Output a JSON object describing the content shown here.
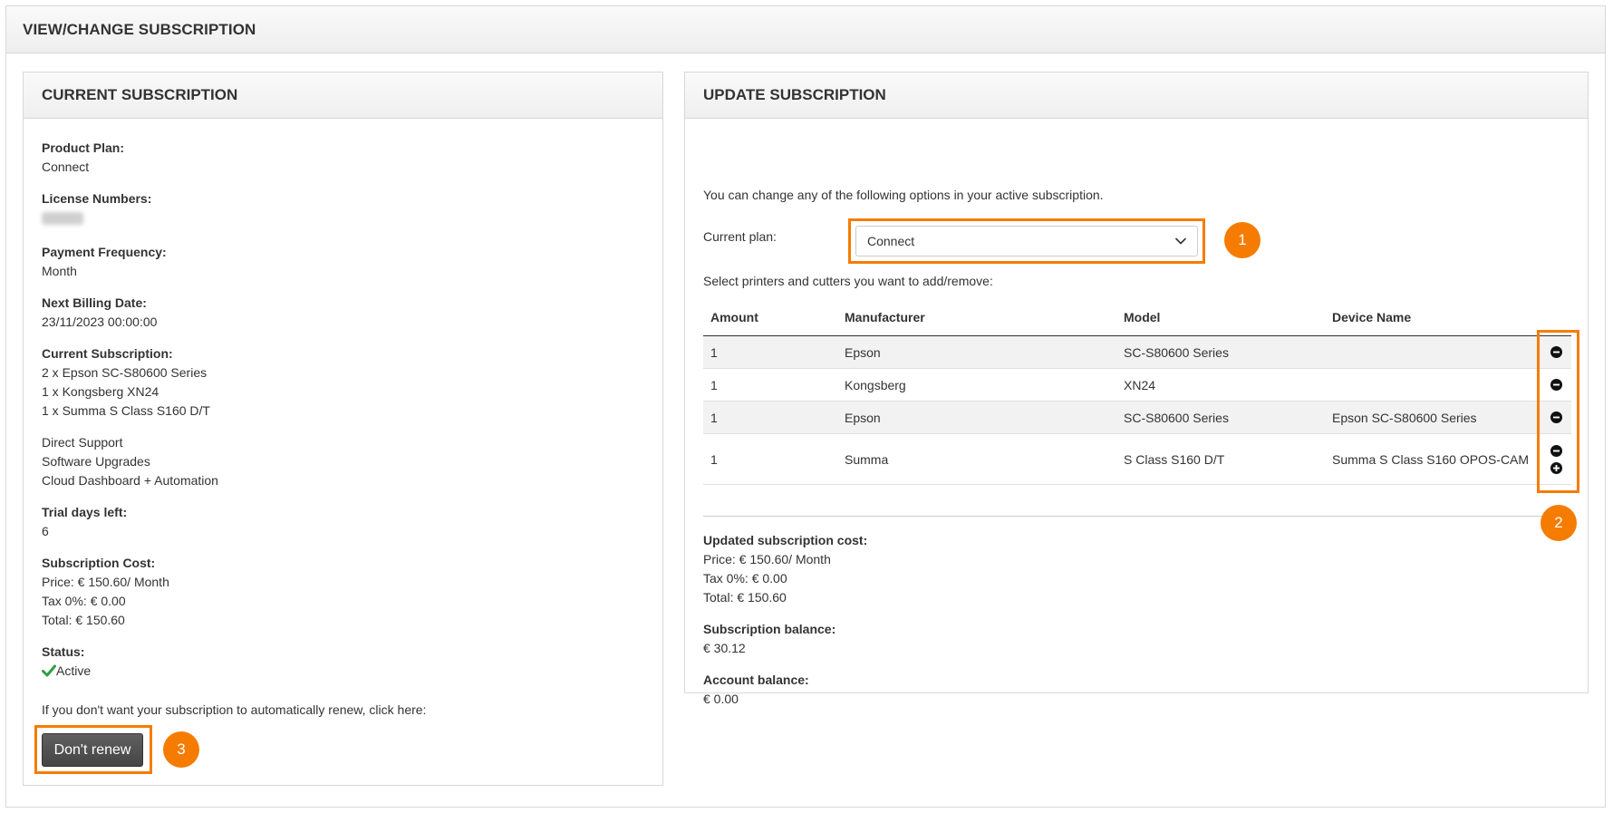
{
  "page": {
    "title": "VIEW/CHANGE SUBSCRIPTION"
  },
  "current": {
    "title": "CURRENT SUBSCRIPTION",
    "product_plan_label": "Product Plan:",
    "product_plan": "Connect",
    "license_label": "License Numbers:",
    "payment_freq_label": "Payment Frequency:",
    "payment_freq": "Month",
    "next_billing_label": "Next Billing Date:",
    "next_billing": "23/11/2023 00:00:00",
    "current_sub_label": "Current Subscription:",
    "current_sub_items": [
      "2 x Epson SC-S80600 Series",
      "1 x Kongsberg XN24",
      "1 x Summa S Class S160 D/T"
    ],
    "features": [
      "Direct Support",
      "Software Upgrades",
      "Cloud Dashboard + Automation"
    ],
    "trial_label": "Trial days left:",
    "trial_days": "6",
    "cost_label": "Subscription Cost:",
    "price": "Price: € 150.60/ Month",
    "tax": "Tax 0%: € 0.00",
    "total": "Total: € 150.60",
    "status_label": "Status:",
    "status": "Active",
    "renew_note": "If you don't want your subscription to automatically renew, click here:",
    "dont_renew_label": "Don't renew"
  },
  "update": {
    "title": "UPDATE SUBSCRIPTION",
    "intro": "You can change any of the following options in your active subscription.",
    "plan_label": "Current plan:",
    "plan_value": "Connect",
    "select_hint": "Select printers and cutters you want to add/remove:",
    "table": {
      "headers": [
        "Amount",
        "Manufacturer",
        "Model",
        "Device Name"
      ],
      "rows": [
        {
          "amount": "1",
          "manufacturer": "Epson",
          "model": "SC-S80600 Series",
          "device": ""
        },
        {
          "amount": "1",
          "manufacturer": "Kongsberg",
          "model": "XN24",
          "device": ""
        },
        {
          "amount": "1",
          "manufacturer": "Epson",
          "model": "SC-S80600 Series",
          "device": "Epson SC-S80600 Series"
        },
        {
          "amount": "1",
          "manufacturer": "Summa",
          "model": "S Class S160 D/T",
          "device": "Summa S Class S160 OPOS-CAM"
        }
      ]
    },
    "updated_cost_label": "Updated subscription cost:",
    "price": "Price: € 150.60/ Month",
    "tax": "Tax 0%: € 0.00",
    "total": "Total: € 150.60",
    "sub_balance_label": "Subscription balance:",
    "sub_balance": "€ 30.12",
    "acct_balance_label": "Account balance:",
    "acct_balance": "€ 0.00"
  },
  "annotations": {
    "badge1": "1",
    "badge2": "2",
    "badge3": "3"
  },
  "colors": {
    "accent": "#f57c00",
    "check": "#2e9e45",
    "button": "#4a4a4a"
  }
}
